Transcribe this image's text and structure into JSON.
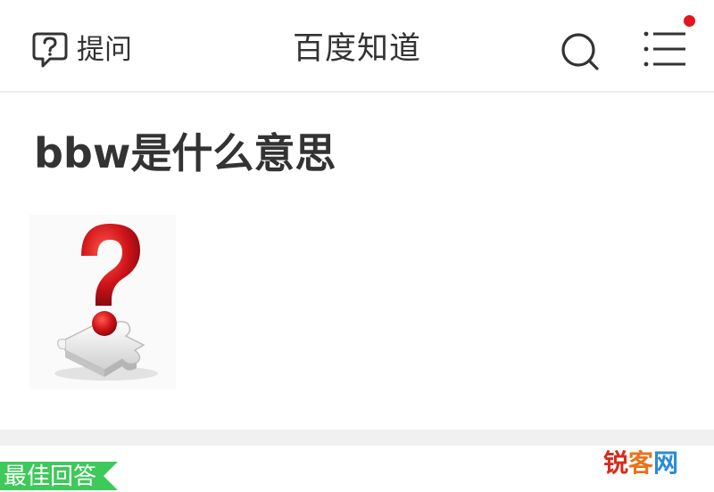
{
  "header": {
    "ask_label": "提问",
    "title": "百度知道",
    "has_notification": true,
    "accent_color": "#e4161d"
  },
  "icons": {
    "ask": "question-bubble-icon",
    "search": "search-icon",
    "menu": "menu-list-icon",
    "notification": "notification-dot-icon"
  },
  "question": {
    "title": "bbw是什么意思",
    "image": "red-question-mark-on-puzzle-piece"
  },
  "answer": {
    "best_label": "最佳回答",
    "tag_color": "#3ec95b"
  },
  "watermark": {
    "part1": "锐",
    "part2": "客",
    "part3": "网"
  }
}
